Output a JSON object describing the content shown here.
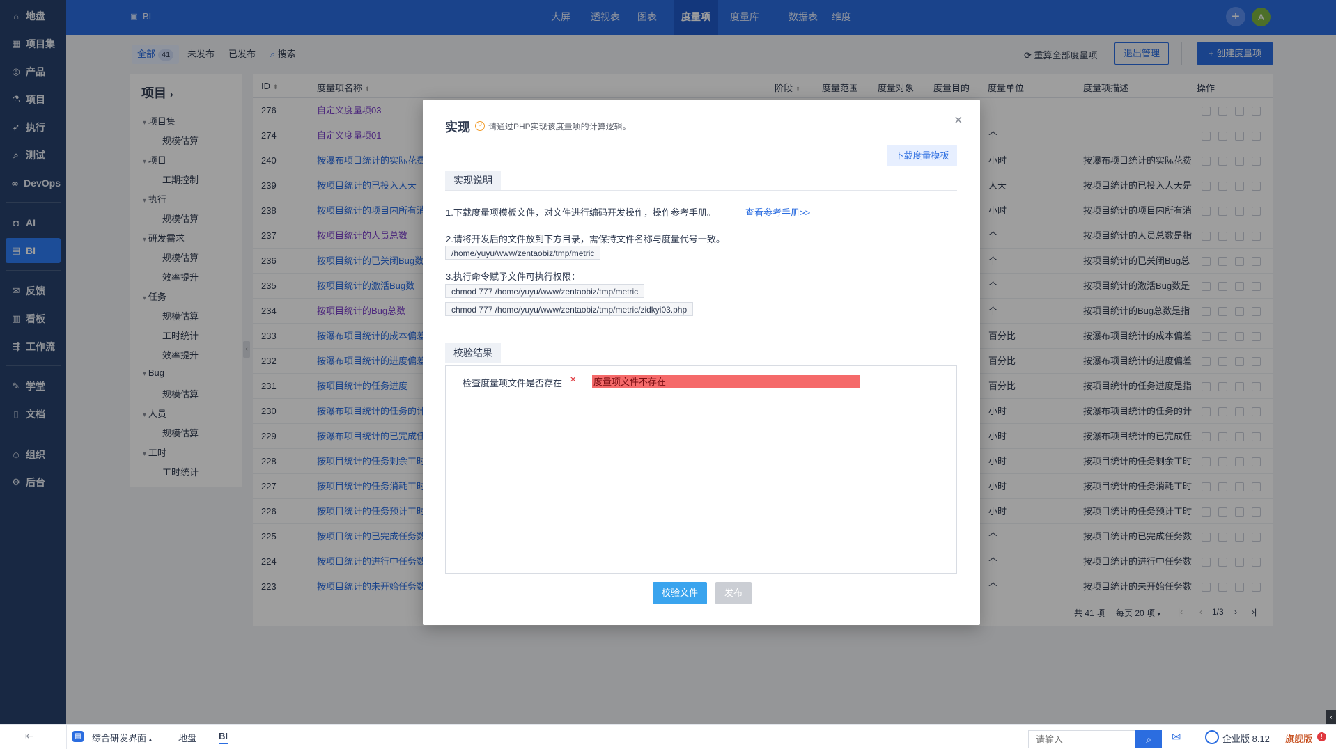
{
  "nav": {
    "items": [
      {
        "label": "地盘",
        "icon": "home-icon"
      },
      {
        "label": "项目集",
        "icon": "grid-icon"
      },
      {
        "label": "产品",
        "icon": "location-icon"
      },
      {
        "label": "项目",
        "icon": "flask-icon"
      },
      {
        "label": "执行",
        "icon": "run-icon"
      },
      {
        "label": "测试",
        "icon": "search-icon"
      },
      {
        "label": "DevOps",
        "icon": "infinity-icon"
      },
      {
        "label": "AI",
        "icon": "robot-icon"
      },
      {
        "label": "BI",
        "icon": "chart-icon"
      },
      {
        "label": "反馈",
        "icon": "feedback-icon"
      },
      {
        "label": "看板",
        "icon": "board-icon"
      },
      {
        "label": "工作流",
        "icon": "flow-icon"
      },
      {
        "label": "学堂",
        "icon": "school-icon"
      },
      {
        "label": "文档",
        "icon": "doc-icon"
      },
      {
        "label": "组织",
        "icon": "people-icon"
      },
      {
        "label": "后台",
        "icon": "settings-icon"
      }
    ],
    "collapse_icon": "collapse-icon"
  },
  "topbar": {
    "app_title": "BI",
    "tabs": [
      "大屏",
      "透视表",
      "图表",
      "度量项",
      "度量库",
      "数据表",
      "维度"
    ],
    "active_tab": "度量项",
    "avatar_letter": "A"
  },
  "toolbar": {
    "filters": [
      {
        "label": "全部",
        "count": "41"
      },
      {
        "label": "未发布"
      },
      {
        "label": "已发布"
      }
    ],
    "search_label": "搜索",
    "recalc_label": "重算全部度量项",
    "exit_label": "退出管理",
    "create_label": "创建度量项"
  },
  "sidetree": {
    "title": "项目",
    "items": [
      {
        "label": "项目集",
        "level": 1
      },
      {
        "label": "规模估算",
        "level": 2
      },
      {
        "label": "项目",
        "level": 1
      },
      {
        "label": "工期控制",
        "level": 2
      },
      {
        "label": "执行",
        "level": 1
      },
      {
        "label": "规模估算",
        "level": 2
      },
      {
        "label": "研发需求",
        "level": 1
      },
      {
        "label": "规模估算",
        "level": 2
      },
      {
        "label": "效率提升",
        "level": 2
      },
      {
        "label": "任务",
        "level": 1
      },
      {
        "label": "规模估算",
        "level": 2
      },
      {
        "label": "工时统计",
        "level": 2
      },
      {
        "label": "效率提升",
        "level": 2
      },
      {
        "label": "Bug",
        "level": 1
      },
      {
        "label": "规模估算",
        "level": 2
      },
      {
        "label": "人员",
        "level": 1
      },
      {
        "label": "规模估算",
        "level": 2
      },
      {
        "label": "工时",
        "level": 1
      },
      {
        "label": "工时统计",
        "level": 2
      }
    ]
  },
  "table": {
    "headers": {
      "id": "ID",
      "name": "度量项名称",
      "stage": "阶段",
      "scope": "度量范围",
      "object": "度量对象",
      "purpose": "度量目的",
      "unit": "度量单位",
      "desc": "度量项描述",
      "actions": "操作"
    },
    "rows": [
      {
        "id": "276",
        "name": "自定义度量项03",
        "unit": "",
        "desc": "",
        "visited": true
      },
      {
        "id": "274",
        "name": "自定义度量项01",
        "unit": "个",
        "desc": "",
        "visited": true
      },
      {
        "id": "240",
        "name": "按瀑布项目统计的实际花费",
        "unit": "小时",
        "desc": "按瀑布项目统计的实际花费"
      },
      {
        "id": "239",
        "name": "按项目统计的已投入人天",
        "unit": "人天",
        "desc": "按项目统计的已投入人天是"
      },
      {
        "id": "238",
        "name": "按项目统计的项目内所有消",
        "unit": "小时",
        "desc": "按项目统计的项目内所有消"
      },
      {
        "id": "237",
        "name": "按项目统计的人员总数",
        "unit": "个",
        "desc": "按项目统计的人员总数是指",
        "visited": true
      },
      {
        "id": "236",
        "name": "按项目统计的已关闭Bug数",
        "unit": "个",
        "desc": "按项目统计的已关闭Bug总"
      },
      {
        "id": "235",
        "name": "按项目统计的激活Bug数",
        "unit": "个",
        "desc": "按项目统计的激活Bug数是"
      },
      {
        "id": "234",
        "name": "按项目统计的Bug总数",
        "unit": "个",
        "desc": "按项目统计的Bug总数是指",
        "visited": true
      },
      {
        "id": "233",
        "name": "按瀑布项目统计的成本偏差",
        "unit": "百分比",
        "desc": "按瀑布项目统计的成本偏差"
      },
      {
        "id": "232",
        "name": "按瀑布项目统计的进度偏差",
        "unit": "百分比",
        "desc": "按瀑布项目统计的进度偏差"
      },
      {
        "id": "231",
        "name": "按项目统计的任务进度",
        "unit": "百分比",
        "desc": "按项目统计的任务进度是指"
      },
      {
        "id": "230",
        "name": "按瀑布项目统计的任务的计",
        "unit": "小时",
        "desc": "按瀑布项目统计的任务的计"
      },
      {
        "id": "229",
        "name": "按瀑布项目统计的已完成任",
        "unit": "小时",
        "desc": "按瀑布项目统计的已完成任"
      },
      {
        "id": "228",
        "name": "按项目统计的任务剩余工时",
        "unit": "小时",
        "desc": "按项目统计的任务剩余工时"
      },
      {
        "id": "227",
        "name": "按项目统计的任务消耗工时",
        "unit": "小时",
        "desc": "按项目统计的任务消耗工时"
      },
      {
        "id": "226",
        "name": "按项目统计的任务预计工时",
        "unit": "小时",
        "desc": "按项目统计的任务预计工时"
      },
      {
        "id": "225",
        "name": "按项目统计的已完成任务数",
        "unit": "个",
        "desc": "按项目统计的已完成任务数"
      },
      {
        "id": "224",
        "name": "按项目统计的进行中任务数",
        "unit": "个",
        "desc": "按项目统计的进行中任务数"
      },
      {
        "id": "223",
        "name": "按项目统计的未开始任务数",
        "unit": "个",
        "desc": "按项目统计的未开始任务数"
      }
    ],
    "pager": {
      "total": "共 41 项",
      "per_page": "每页 20 项",
      "page": "1/3"
    }
  },
  "modal": {
    "title": "实现",
    "hint": "请通过PHP实现该度量项的计算逻辑。",
    "download_label": "下载度量模板",
    "section1_title": "实现说明",
    "step1": "1.下载度量项模板文件，对文件进行编码开发操作，操作参考手册。",
    "step1_link": "查看参考手册>>",
    "step2": "2.请将开发后的文件放到下方目录，需保持文件名称与度量代号一致。",
    "path": "/home/yuyu/www/zentaobiz/tmp/metric",
    "step3": "3.执行命令赋予文件可执行权限：",
    "cmd1": "chmod 777 /home/yuyu/www/zentaobiz/tmp/metric",
    "cmd2": "chmod 777 /home/yuyu/www/zentaobiz/tmp/metric/zidkyi03.php",
    "section2_title": "校验结果",
    "check_label": "检查度量项文件是否存在",
    "check_mark": "×",
    "check_error": "度量项文件不存在",
    "verify_label": "校验文件",
    "publish_label": "发布",
    "close_icon": "close-icon"
  },
  "bottombar": {
    "workspace": "综合研发界面",
    "crumbs": [
      "地盘",
      "BI"
    ],
    "search_placeholder": "请输入",
    "version": "企业版 8.12",
    "edition": "旗舰版"
  }
}
